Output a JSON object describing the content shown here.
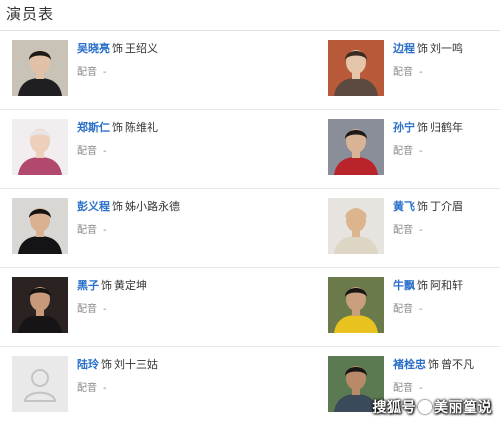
{
  "section_title": "演员表",
  "dub_label": "配音",
  "as_label": "饰",
  "cast": [
    {
      "actor": "吴晓亮",
      "role": "王绍义",
      "dub": "-",
      "photo": {
        "bg": "#c9c2b6",
        "skin": "#e2c2a6",
        "hair": "#1e1a17",
        "cloth": "#1f1f22"
      }
    },
    {
      "actor": "边程",
      "role": "刘一鸣",
      "dub": "-",
      "photo": {
        "bg": "#b85a3a",
        "skin": "#e6c6aa",
        "hair": "#3a2a22",
        "cloth": "#5a4a40"
      }
    },
    {
      "actor": "郑斯仁",
      "role": "陈维礼",
      "dub": "-",
      "photo": {
        "bg": "#f2eef0",
        "skin": "#ecd0bc",
        "hair": "#e9e4e8",
        "cloth": "#b2486e"
      }
    },
    {
      "actor": "孙宁",
      "role": "归鹤年",
      "dub": "-",
      "photo": {
        "bg": "#8a8e99",
        "skin": "#d8b396",
        "hair": "#1f1a18",
        "cloth": "#b9242a"
      }
    },
    {
      "actor": "彭义程",
      "role": "姊小路永德",
      "dub": "-",
      "photo": {
        "bg": "#d9d7d3",
        "skin": "#d9b090",
        "hair": "#161412",
        "cloth": "#141416"
      }
    },
    {
      "actor": "黄飞",
      "role": "丁介眉",
      "dub": "-",
      "photo": {
        "bg": "#e7e3de",
        "skin": "#dcb58f",
        "hair": "#dcb58f",
        "cloth": "#ddd6c4"
      }
    },
    {
      "actor": "黑子",
      "role": "黄定坤",
      "dub": "-",
      "photo": {
        "bg": "#2a2322",
        "skin": "#c89a7a",
        "hair": "#141111",
        "cloth": "#161415"
      }
    },
    {
      "actor": "牛飘",
      "role": "阿和轩",
      "dub": "-",
      "photo": {
        "bg": "#6b7a4a",
        "skin": "#c99f7d",
        "hair": "#1a1615",
        "cloth": "#e8c21e"
      }
    },
    {
      "actor": "陆玲",
      "role": "刘十三姑",
      "dub": "-",
      "photo": {
        "placeholder": true
      }
    },
    {
      "actor": "褚栓忠",
      "role": "曾不凡",
      "dub": "-",
      "photo": {
        "bg": "#5b7a52",
        "skin": "#b88a6a",
        "hair": "#1a1615",
        "cloth": "#3b4a5a"
      }
    }
  ],
  "watermark": {
    "brand": "搜狐号",
    "author": "美丽篁说"
  }
}
